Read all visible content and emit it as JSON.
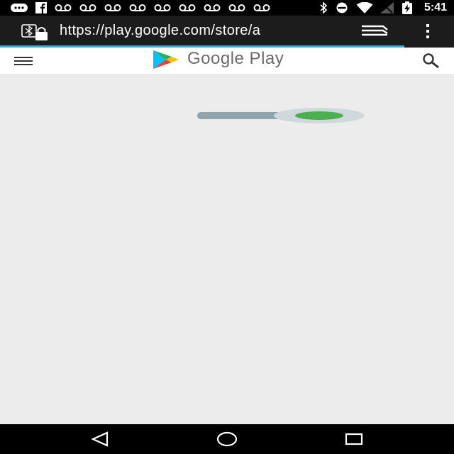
{
  "status_bar": {
    "time": "5:41",
    "left_icons": [
      "notification-dots-icon",
      "facebook-icon",
      "voicemail-icon",
      "voicemail-icon",
      "voicemail-icon",
      "voicemail-icon",
      "voicemail-icon",
      "voicemail-icon",
      "voicemail-icon",
      "voicemail-icon",
      "voicemail-icon"
    ],
    "right_icons": [
      "bluetooth-icon",
      "do-not-disturb-icon",
      "wifi-icon",
      "no-signal-icon",
      "battery-charging-icon"
    ]
  },
  "browser": {
    "url": "https://play.google.com/store/a",
    "load_progress": 0.89
  },
  "header": {
    "title": "Google Play"
  },
  "loader": {
    "track_color": "#90a4ae",
    "dot_color": "#4caf50"
  },
  "colors": {
    "status_bar": "#000000",
    "browser_bar": "#1c1c1c",
    "progress": "#3fa8d8",
    "page_background": "#ececec",
    "header_background": "#ffffff"
  }
}
